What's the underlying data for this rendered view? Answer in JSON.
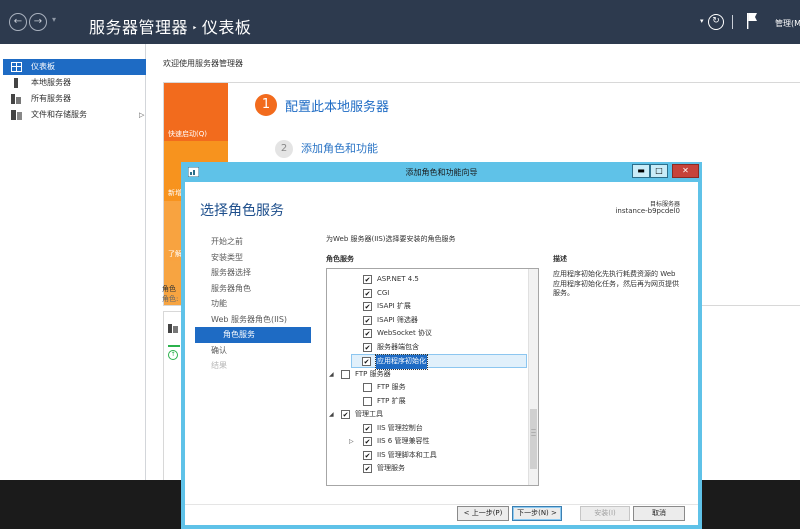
{
  "server_manager": {
    "title_main": "服务器管理器",
    "title_sep": "‣",
    "title_page": "仪表板",
    "toolbar": {
      "refresh_icon": "refresh-icon",
      "flag_icon": "flag-icon",
      "manage_label": "管理(M)"
    },
    "sidebar": {
      "items": [
        {
          "label": "仪表板",
          "icon": "dashboard-icon",
          "active": true
        },
        {
          "label": "本地服务器",
          "icon": "server-icon"
        },
        {
          "label": "所有服务器",
          "icon": "servers-icon"
        },
        {
          "label": "文件和存储服务",
          "icon": "storage-icon",
          "arrow": "▷"
        }
      ]
    },
    "welcome": "欢迎使用服务器管理器",
    "quick_start": {
      "quick_label": "快速启动(Q)",
      "new_label": "新增",
      "learn_label": "了解",
      "step1_num": "1",
      "step1_label": "配置此本地服务器",
      "step2_num": "2",
      "step2_label": "添加角色和功能"
    },
    "roles_group": {
      "title": "角色",
      "subtitle": "角色:"
    }
  },
  "wizard": {
    "title": "添加角色和功能向导",
    "window_buttons": {
      "min": "▬",
      "max": "□",
      "close": "✕"
    },
    "heading": "选择角色服务",
    "target_label": "目标服务器",
    "target_value": "instance-b9pcdel0",
    "steps": [
      {
        "label": "开始之前"
      },
      {
        "label": "安装类型"
      },
      {
        "label": "服务器选择"
      },
      {
        "label": "服务器角色"
      },
      {
        "label": "功能"
      },
      {
        "label": "Web 服务器角色(IIS)"
      },
      {
        "label": "角色服务",
        "active": true
      },
      {
        "label": "确认"
      },
      {
        "label": "结果",
        "disabled": true
      }
    ],
    "description_line": "为Web 服务器(IIS)选择要安装的角色服务",
    "role_services_header": "角色服务",
    "tree": [
      {
        "label": "ASP.NET 4.5",
        "checked": true
      },
      {
        "label": "CGI",
        "checked": true
      },
      {
        "label": "ISAPI 扩展",
        "checked": true
      },
      {
        "label": "ISAPI 筛选器",
        "checked": true
      },
      {
        "label": "WebSocket 协议",
        "checked": true
      },
      {
        "label": "服务器端包含",
        "checked": true
      },
      {
        "label": "应用程序初始化",
        "checked": true,
        "selected": true
      },
      {
        "label": "FTP 服务器",
        "checked": false,
        "expand": "◢"
      },
      {
        "label": "FTP 服务",
        "checked": false
      },
      {
        "label": "FTP 扩展",
        "checked": false
      },
      {
        "label": "管理工具",
        "checked": true,
        "expand": "◢"
      },
      {
        "label": "IIS 管理控制台",
        "checked": true
      },
      {
        "label": "IIS 6 管理兼容性",
        "checked": true,
        "expand": "▷"
      },
      {
        "label": "IIS 管理脚本和工具",
        "checked": true
      },
      {
        "label": "管理服务",
        "checked": true
      }
    ],
    "desc_header": "描述",
    "desc_text": "应用程序初始化先执行耗费资源的 Web 应用程序初始化任务，然后再为网页提供服务。",
    "buttons": {
      "prev": "< 上一步(P)",
      "next": "下一步(N) >",
      "install": "安装(I)",
      "cancel": "取消"
    }
  }
}
